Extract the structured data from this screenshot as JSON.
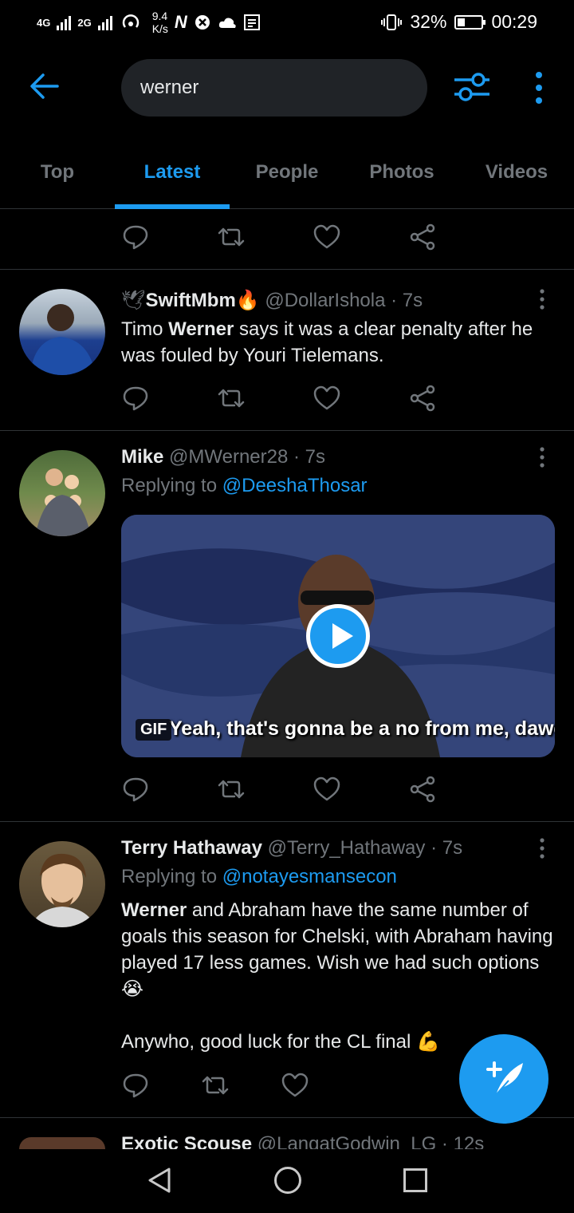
{
  "status_bar": {
    "network1": "4G",
    "network2": "2G",
    "speed": "9.4",
    "speed_unit": "K/s",
    "battery": "32%",
    "battery_level": 0.32,
    "time": "00:29"
  },
  "search": {
    "query": "werner"
  },
  "tabs": [
    {
      "label": "Top"
    },
    {
      "label": "Latest"
    },
    {
      "label": "People"
    },
    {
      "label": "Photos"
    },
    {
      "label": "Videos"
    }
  ],
  "active_tab": "Latest",
  "tweets": [
    {
      "name": "SwiftMbm",
      "handle": "@DollarIshola",
      "time": "· 7s",
      "body_bold": "Werner",
      "body_pre": "Timo ",
      "body_post": " says it was a clear penalty after he was fouled by Youri Tielemans."
    },
    {
      "name": "Mike",
      "handle": "@MWerner28",
      "time": "· 7s",
      "reply_prefix": "Replying to ",
      "reply_to": "@DeeshaThosar",
      "media": {
        "badge": "GIF",
        "caption": "Yeah, that's gonna be a no from me, dawg"
      }
    },
    {
      "name": "Terry Hathaway",
      "handle": "@Terry_Hathaway",
      "time": "· 7s",
      "reply_prefix": "Replying to ",
      "reply_to": "@notayesmansecon",
      "body_bold": "Werner",
      "body_post": " and Abraham have the same number of goals this season for Chelski, with Abraham having played 17 less games. Wish we had such options 😭",
      "body_line2": "Anywho, good luck for the CL final 💪"
    },
    {
      "name": "Exotic Scouse",
      "handle": "@LangatGodwin_LG",
      "time": "· 12s"
    }
  ],
  "colors": {
    "accent": "#1d9bf0",
    "background": "#000000",
    "text_secondary": "#71767b"
  }
}
